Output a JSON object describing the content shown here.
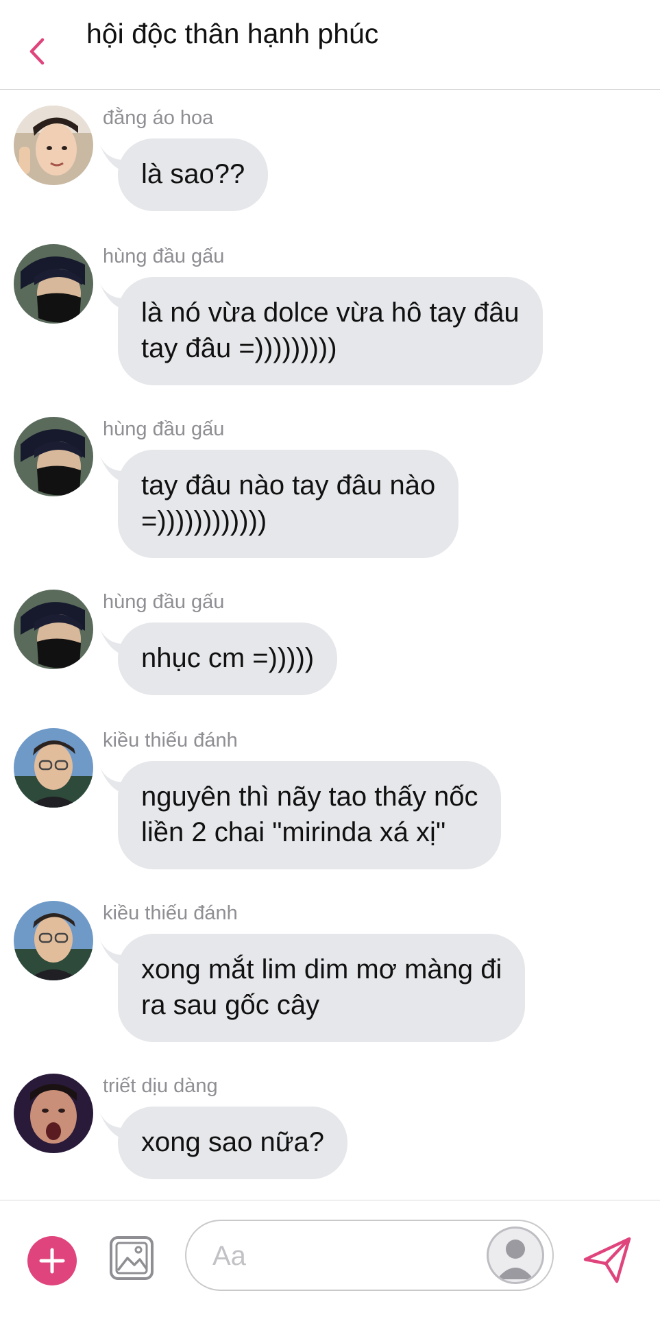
{
  "header": {
    "title": "hội độc thân hạnh phúc"
  },
  "messages": [
    {
      "sender": "đằng áo hoa",
      "text": "là sao??"
    },
    {
      "sender": "hùng đầu gấu",
      "text": "là nó vừa dolce vừa hô tay đâu\ntay đâu =)))))))))"
    },
    {
      "sender": "hùng đầu gấu",
      "text": "tay đâu nào tay đâu nào\n=))))))))))))"
    },
    {
      "sender": "hùng đầu gấu",
      "text": "nhục cm =)))))"
    },
    {
      "sender": "kiều thiếu đánh",
      "text": "nguyên thì nãy tao thấy nốc\nliền 2 chai \"mirinda xá xị\""
    },
    {
      "sender": "kiều thiếu đánh",
      "text": "xong mắt lim dim mơ màng đi\nra sau gốc cây"
    },
    {
      "sender": "triết dịu dàng",
      "text": "xong sao nữa?"
    }
  ],
  "composer": {
    "placeholder": "Aa"
  },
  "icons": {
    "back": "chevron-left-icon",
    "plus": "plus-icon",
    "image": "image-icon",
    "sticker": "avatar-sticker-icon",
    "send": "send-icon"
  },
  "colors": {
    "accent": "#e0447c",
    "bubble": "#e6e7ea",
    "sender": "#8e8e93"
  }
}
